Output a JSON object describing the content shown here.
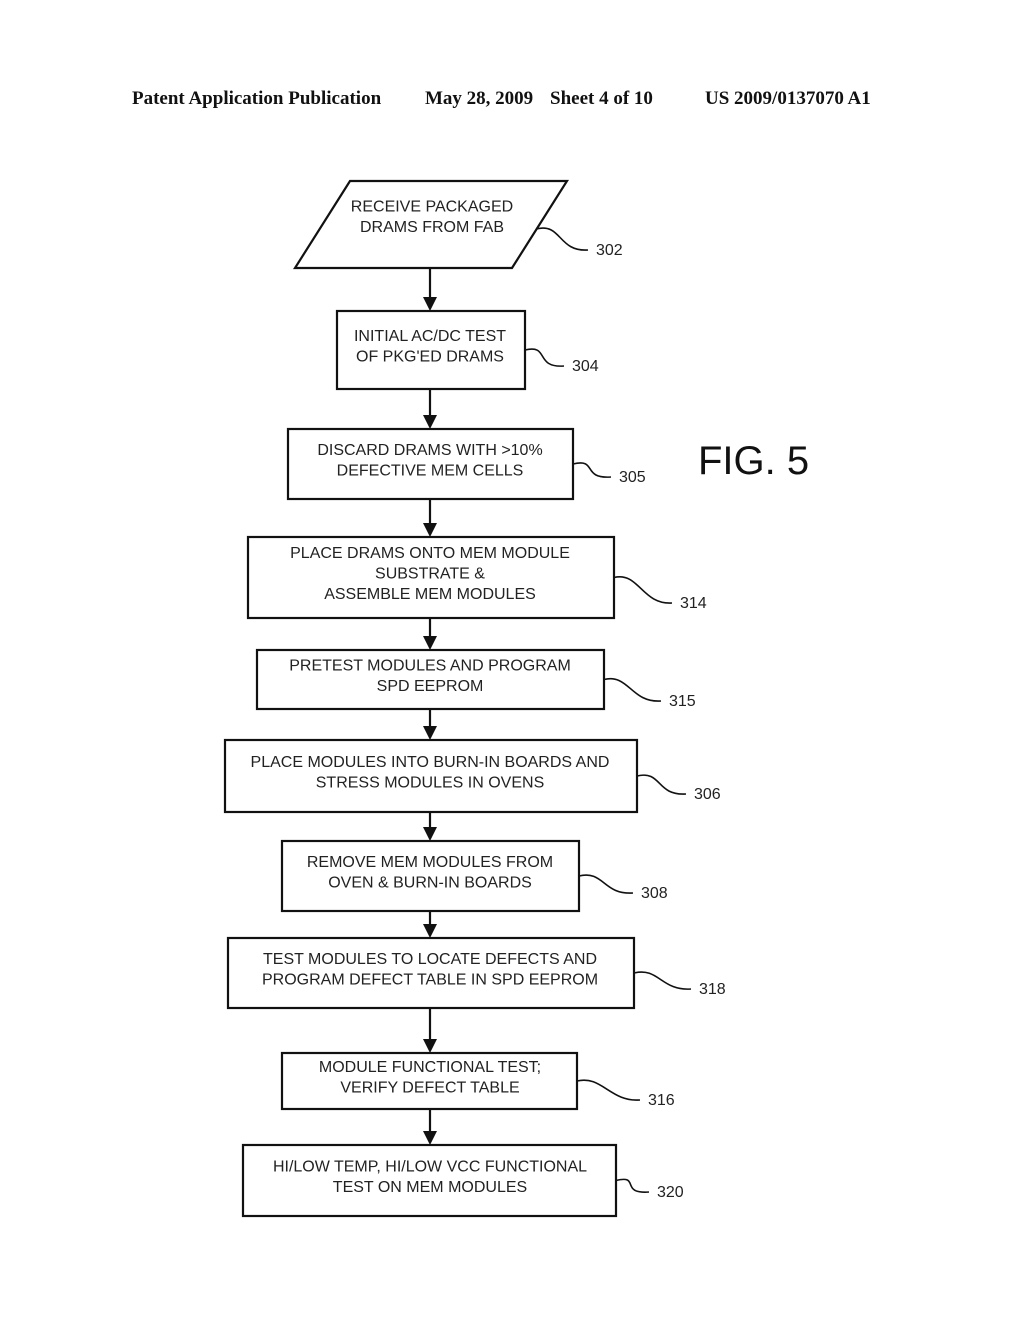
{
  "header": {
    "publication": "Patent Application Publication",
    "date": "May 28, 2009",
    "sheet": "Sheet 4 of 10",
    "number": "US 2009/0137070 A1"
  },
  "figure_label": "FIG. 5",
  "steps": [
    {
      "ref": "302",
      "shape": "parallelogram",
      "lines": [
        "RECEIVE PACKAGED",
        "DRAMS FROM FAB"
      ]
    },
    {
      "ref": "304",
      "shape": "rectangle",
      "lines": [
        "INITIAL AC/DC TEST",
        "OF PKG'ED DRAMS"
      ]
    },
    {
      "ref": "305",
      "shape": "rectangle",
      "lines": [
        "DISCARD DRAMS WITH >10%",
        "DEFECTIVE MEM CELLS"
      ]
    },
    {
      "ref": "314",
      "shape": "rectangle",
      "lines": [
        "PLACE DRAMS ONTO MEM MODULE",
        "SUBSTRATE &",
        "ASSEMBLE MEM MODULES"
      ]
    },
    {
      "ref": "315",
      "shape": "rectangle",
      "lines": [
        "PRETEST MODULES AND PROGRAM",
        "SPD EEPROM"
      ]
    },
    {
      "ref": "306",
      "shape": "rectangle",
      "lines": [
        "PLACE MODULES INTO BURN-IN BOARDS AND",
        "STRESS MODULES IN OVENS"
      ]
    },
    {
      "ref": "308",
      "shape": "rectangle",
      "lines": [
        "REMOVE MEM MODULES FROM",
        "OVEN & BURN-IN BOARDS"
      ]
    },
    {
      "ref": "318",
      "shape": "rectangle",
      "lines": [
        "TEST MODULES TO LOCATE DEFECTS AND",
        "PROGRAM DEFECT TABLE IN SPD EEPROM"
      ]
    },
    {
      "ref": "316",
      "shape": "rectangle",
      "lines": [
        "MODULE FUNCTIONAL TEST;",
        "VERIFY DEFECT TABLE"
      ]
    },
    {
      "ref": "320",
      "shape": "rectangle",
      "lines": [
        "HI/LOW TEMP, HI/LOW VCC FUNCTIONAL",
        "TEST ON MEM MODULES"
      ]
    }
  ]
}
